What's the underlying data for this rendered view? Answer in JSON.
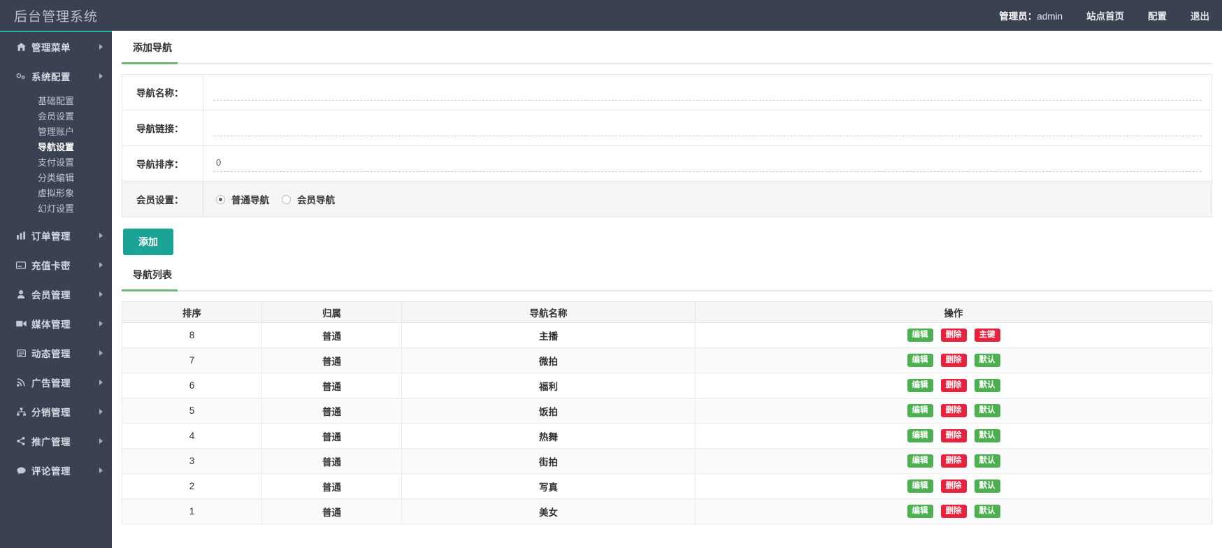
{
  "header": {
    "brand": "后台管理系统",
    "admin_prefix": "管理员：",
    "admin_name": "admin",
    "site_home": "站点首页",
    "config": "配置",
    "logout": "退出"
  },
  "sidebar": {
    "groups": [
      {
        "icon": "home-icon",
        "label": "管理菜单",
        "caret": true,
        "submenu": []
      },
      {
        "icon": "gears-icon",
        "label": "系统配置",
        "caret": true,
        "submenu": [
          {
            "label": "基础配置",
            "active": false
          },
          {
            "label": "会员设置",
            "active": false
          },
          {
            "label": "管理账户",
            "active": false
          },
          {
            "label": "导航设置",
            "active": true
          },
          {
            "label": "支付设置",
            "active": false
          },
          {
            "label": "分类编辑",
            "active": false
          },
          {
            "label": "虚拟形象",
            "active": false
          },
          {
            "label": "幻灯设置",
            "active": false
          }
        ]
      },
      {
        "icon": "chart-icon",
        "label": "订单管理",
        "caret": true,
        "submenu": []
      },
      {
        "icon": "card-icon",
        "label": "充值卡密",
        "caret": true,
        "submenu": []
      },
      {
        "icon": "user-icon",
        "label": "会员管理",
        "caret": true,
        "submenu": []
      },
      {
        "icon": "video-icon",
        "label": "媒体管理",
        "caret": true,
        "submenu": []
      },
      {
        "icon": "news-icon",
        "label": "动态管理",
        "caret": true,
        "submenu": []
      },
      {
        "icon": "rss-icon",
        "label": "广告管理",
        "caret": true,
        "submenu": []
      },
      {
        "icon": "sitemap-icon",
        "label": "分销管理",
        "caret": true,
        "submenu": []
      },
      {
        "icon": "share-icon",
        "label": "推广管理",
        "caret": true,
        "submenu": []
      },
      {
        "icon": "comment-icon",
        "label": "评论管理",
        "caret": true,
        "submenu": []
      }
    ]
  },
  "add_panel": {
    "tab_label": "添加导航",
    "fields": {
      "name_label": "导航名称：",
      "name_value": "",
      "name_placeholder": "",
      "link_label": "导航链接：",
      "link_value": "",
      "link_placeholder": "",
      "sort_label": "导航排序：",
      "sort_value": "0",
      "member_label": "会员设置：",
      "radio_normal": "普通导航",
      "radio_member": "会员导航",
      "radio_selected": "普通导航"
    },
    "submit_label": "添加"
  },
  "list_panel": {
    "tab_label": "导航列表",
    "columns": [
      "排序",
      "归属",
      "导航名称",
      "操作"
    ],
    "rows": [
      {
        "sort": "8",
        "own": "普通",
        "name": "主播",
        "actions": [
          {
            "label": "编辑",
            "style": "green"
          },
          {
            "label": "删除",
            "style": "red"
          },
          {
            "label": "主键",
            "style": "red"
          }
        ]
      },
      {
        "sort": "7",
        "own": "普通",
        "name": "微拍",
        "actions": [
          {
            "label": "编辑",
            "style": "green"
          },
          {
            "label": "删除",
            "style": "red"
          },
          {
            "label": "默认",
            "style": "green"
          }
        ]
      },
      {
        "sort": "6",
        "own": "普通",
        "name": "福利",
        "actions": [
          {
            "label": "编辑",
            "style": "green"
          },
          {
            "label": "删除",
            "style": "red"
          },
          {
            "label": "默认",
            "style": "green"
          }
        ]
      },
      {
        "sort": "5",
        "own": "普通",
        "name": "饭拍",
        "actions": [
          {
            "label": "编辑",
            "style": "green"
          },
          {
            "label": "删除",
            "style": "red"
          },
          {
            "label": "默认",
            "style": "green"
          }
        ]
      },
      {
        "sort": "4",
        "own": "普通",
        "name": "热舞",
        "actions": [
          {
            "label": "编辑",
            "style": "green"
          },
          {
            "label": "删除",
            "style": "red"
          },
          {
            "label": "默认",
            "style": "green"
          }
        ]
      },
      {
        "sort": "3",
        "own": "普通",
        "name": "街拍",
        "actions": [
          {
            "label": "编辑",
            "style": "green"
          },
          {
            "label": "删除",
            "style": "red"
          },
          {
            "label": "默认",
            "style": "green"
          }
        ]
      },
      {
        "sort": "2",
        "own": "普通",
        "name": "写真",
        "actions": [
          {
            "label": "编辑",
            "style": "green"
          },
          {
            "label": "删除",
            "style": "red"
          },
          {
            "label": "默认",
            "style": "green"
          }
        ]
      },
      {
        "sort": "1",
        "own": "普通",
        "name": "美女",
        "actions": [
          {
            "label": "编辑",
            "style": "green"
          },
          {
            "label": "删除",
            "style": "red"
          },
          {
            "label": "默认",
            "style": "green"
          }
        ]
      }
    ]
  },
  "colors": {
    "sidebar_bg": "#3a4151",
    "accent_teal": "#1ba396",
    "tab_underline": "#71b57a",
    "btn_green": "#4caf50",
    "btn_red": "#e8223c"
  }
}
